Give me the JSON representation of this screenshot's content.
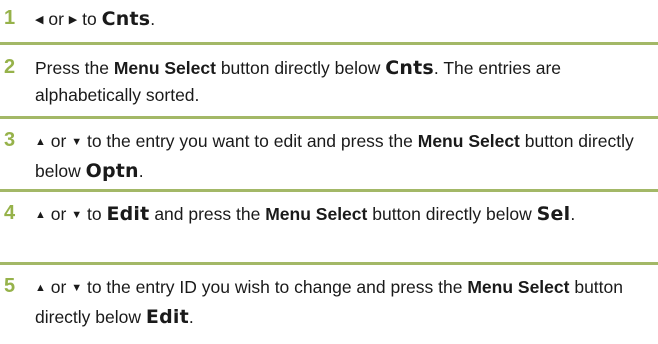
{
  "steps": [
    {
      "number": "1",
      "icon_left": "◀",
      "word_or": "or",
      "icon_right": "▶",
      "to": "to",
      "display_word": "Cnts",
      "period": "."
    },
    {
      "number": "2",
      "press": "Press the",
      "menu_select": "Menu Select",
      "button_below": "button directly below",
      "display_word": "Cnts",
      "tail": ". The entries are alphabetically sorted."
    },
    {
      "number": "3",
      "icon_up": "▲",
      "word_or": "or",
      "icon_down": "▼",
      "mid": "to the entry you want to edit and press the",
      "menu": "Menu",
      "select": "Select",
      "button_below": "button directly below",
      "display_word": "Optn",
      "period": "."
    },
    {
      "number": "4",
      "icon_up": "▲",
      "word_or": "or",
      "icon_down": "▼",
      "to": "to",
      "display_word_1": "Edit",
      "and_press": "and press the",
      "menu_select": "Menu Select",
      "button_below": "button directly below",
      "display_word_2": "Sel",
      "period": "."
    },
    {
      "number": "5",
      "icon_up": "▲",
      "word_or": "or",
      "icon_down": "▼",
      "mid": "to the entry ID you wish to change and press the",
      "menu_select": "Menu Select",
      "button_below": "button directly below",
      "display_word": "Edit",
      "period": "."
    }
  ],
  "colors": {
    "step_number": "#96b24a",
    "rule": "#a3b867",
    "text": "#1a1a1a"
  }
}
